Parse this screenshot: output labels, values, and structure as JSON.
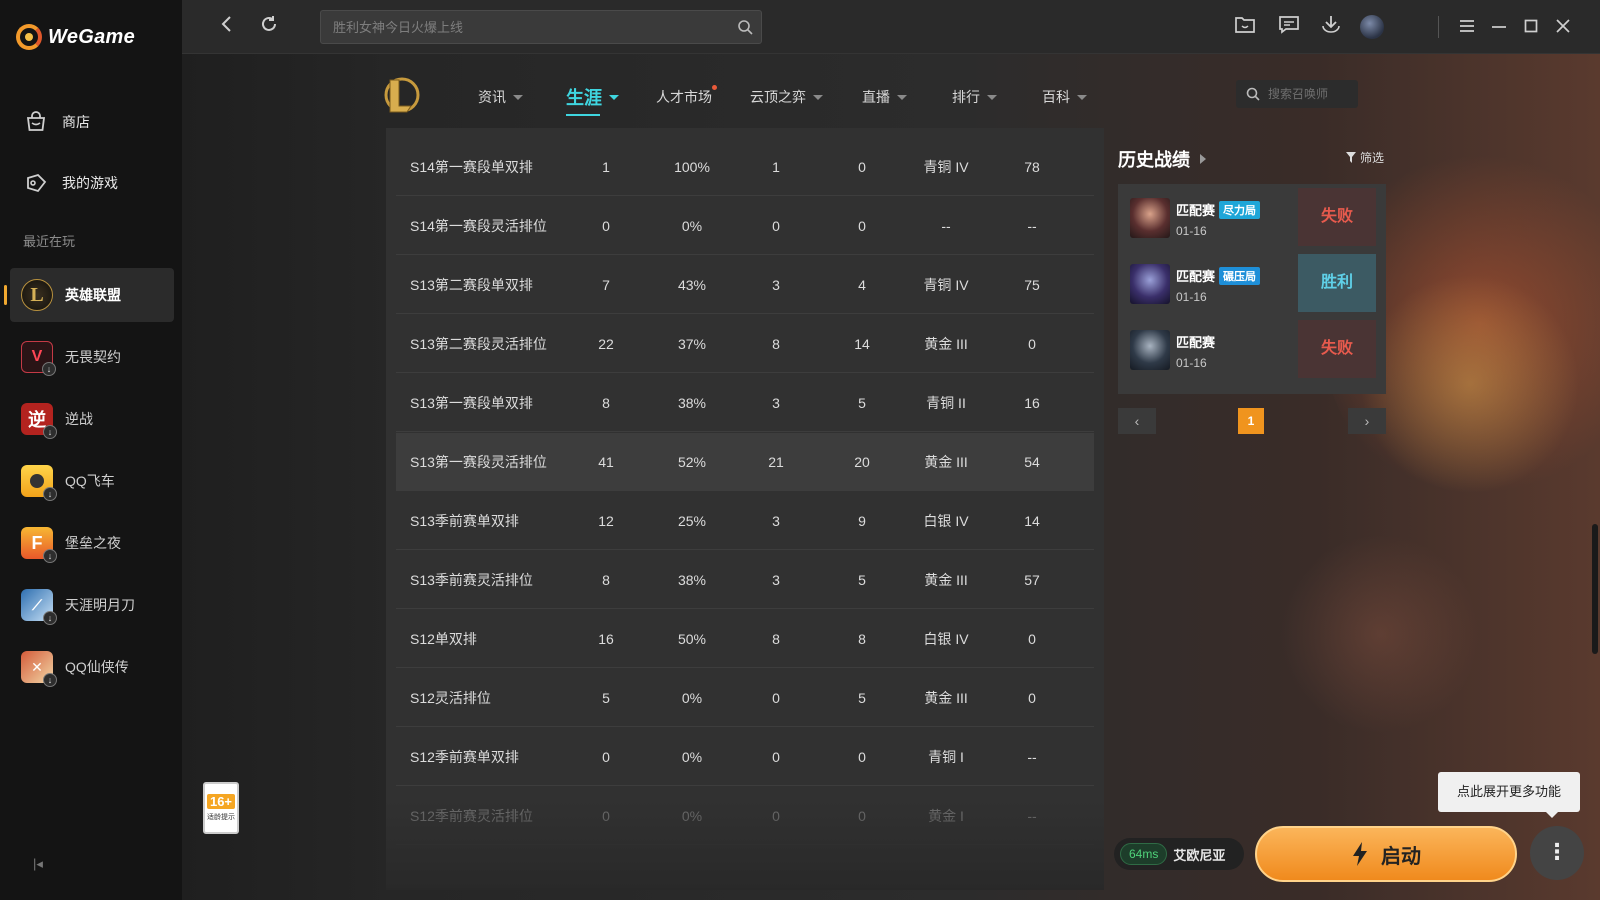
{
  "app": {
    "brand": "WeGame"
  },
  "sidebar": {
    "nav": [
      {
        "label": "商店",
        "icon": "store-bag-icon"
      },
      {
        "label": "我的游戏",
        "icon": "gamepad-icon"
      }
    ],
    "recent_label": "最近在玩",
    "games": [
      {
        "label": "英雄联盟",
        "icon": "league-of-legends-icon",
        "active": true
      },
      {
        "label": "无畏契约",
        "icon": "valorant-icon"
      },
      {
        "label": "逆战",
        "icon": "nizhan-icon"
      },
      {
        "label": "QQ飞车",
        "icon": "qq-speed-icon"
      },
      {
        "label": "堡垒之夜",
        "icon": "fortnite-icon"
      },
      {
        "label": "天涯明月刀",
        "icon": "tianya-icon"
      },
      {
        "label": "QQ仙侠传",
        "icon": "qq-xianxia-icon"
      }
    ],
    "age_rating": {
      "number": "16+",
      "text": "适龄提示"
    }
  },
  "topbar": {
    "search_placeholder": "胜利女神今日火爆上线"
  },
  "game_nav": {
    "tabs": [
      {
        "label": "资讯"
      },
      {
        "label": "生涯",
        "active": true
      },
      {
        "label": "人才市场",
        "dot": true
      },
      {
        "label": "云顶之弈"
      },
      {
        "label": "直播"
      },
      {
        "label": "排行"
      },
      {
        "label": "百科"
      }
    ],
    "summoner_search_placeholder": "搜索召唤师"
  },
  "season_table": {
    "rows": [
      [
        "S14第一赛段单双排",
        "1",
        "100%",
        "1",
        "0",
        "青铜 IV",
        "78"
      ],
      [
        "S14第一赛段灵活排位",
        "0",
        "0%",
        "0",
        "0",
        "--",
        "--"
      ],
      [
        "S13第二赛段单双排",
        "7",
        "43%",
        "3",
        "4",
        "青铜 IV",
        "75"
      ],
      [
        "S13第二赛段灵活排位",
        "22",
        "37%",
        "8",
        "14",
        "黄金 III",
        "0"
      ],
      [
        "S13第一赛段单双排",
        "8",
        "38%",
        "3",
        "5",
        "青铜 II",
        "16"
      ],
      [
        "S13第一赛段灵活排位",
        "41",
        "52%",
        "21",
        "20",
        "黄金 III",
        "54"
      ],
      [
        "S13季前赛单双排",
        "12",
        "25%",
        "3",
        "9",
        "白银 IV",
        "14"
      ],
      [
        "S13季前赛灵活排位",
        "8",
        "38%",
        "3",
        "5",
        "黄金 III",
        "57"
      ],
      [
        "S12单双排",
        "16",
        "50%",
        "8",
        "8",
        "白银 IV",
        "0"
      ],
      [
        "S12灵活排位",
        "5",
        "0%",
        "0",
        "5",
        "黄金 III",
        "0"
      ],
      [
        "S12季前赛单双排",
        "0",
        "0%",
        "0",
        "0",
        "青铜 I",
        "--"
      ],
      [
        "S12季前赛灵活排位",
        "0",
        "0%",
        "0",
        "0",
        "黄金 I",
        "--"
      ]
    ],
    "highlighted_row": 5
  },
  "history": {
    "title": "历史战绩",
    "filter_label": "筛选",
    "matches": [
      {
        "mode": "匹配赛",
        "tag": "尽力局",
        "date": "01-16",
        "result": "失败",
        "outcome": "loss"
      },
      {
        "mode": "匹配赛",
        "tag": "碾压局",
        "date": "01-16",
        "result": "胜利",
        "outcome": "win"
      },
      {
        "mode": "匹配赛",
        "tag": "",
        "date": "01-16",
        "result": "失败",
        "outcome": "loss"
      }
    ],
    "current_page": "1"
  },
  "footer": {
    "ping": "64ms",
    "server": "艾欧尼亚",
    "launch_label": "启动",
    "tooltip": "点此展开更多功能"
  },
  "colors": {
    "accent": "#3fd6e0",
    "launch": "#f5a33a",
    "loss": "#e75a4d",
    "win": "#5fd0e8"
  }
}
